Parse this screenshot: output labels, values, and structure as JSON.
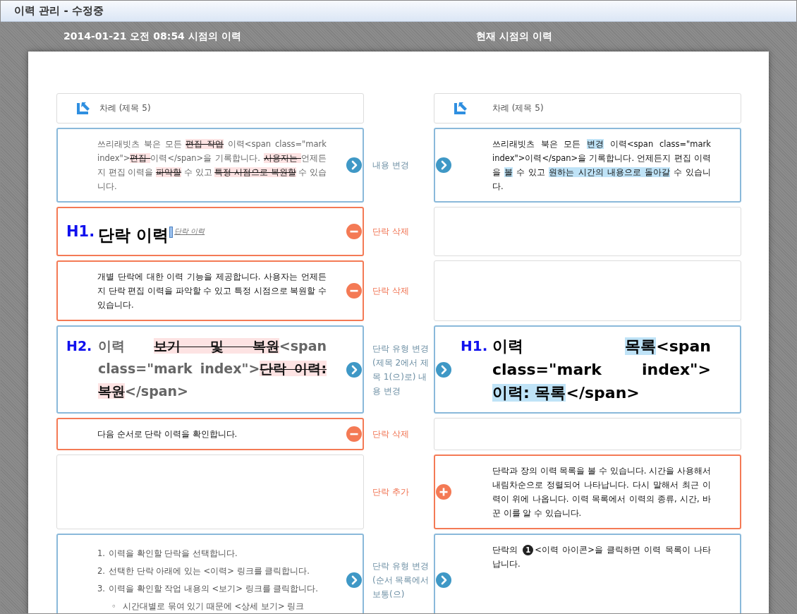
{
  "window": {
    "title": "이력 관리 - 수정중"
  },
  "columns": [
    {
      "title": "2014-01-21 오전 08:54 시점의 이력"
    },
    {
      "title": "현재 시점의 이력"
    }
  ],
  "rows": [
    {
      "left": {
        "kind": "toc",
        "text": "차례 (제목 5)"
      },
      "right": {
        "kind": "toc",
        "text": "차례 (제목 5)"
      }
    },
    {
      "left": {
        "kind": "paragraph",
        "segments": [
          {
            "text": "쓰리래빗츠 북은 모든 "
          },
          {
            "text": "편집 작업",
            "deleted": true
          },
          {
            "text": " 이력<span class=\"mark index\">"
          },
          {
            "text": "편집 ",
            "deleted": true
          },
          {
            "text": "이력</span>을 기록합니다. "
          },
          {
            "text": "사용자는 ",
            "deleted": true
          },
          {
            "text": "언제든지 편집 이력을 "
          },
          {
            "text": "파악할",
            "deleted": true
          },
          {
            "text": " 수 있고 "
          },
          {
            "text": "특정 시점으로 복원할",
            "deleted": true
          },
          {
            "text": " 수 있습니다."
          }
        ]
      },
      "change": {
        "kind": "modify",
        "label": "내용 변경"
      },
      "right": {
        "kind": "paragraph",
        "segments": [
          {
            "text": "쓰리래빗츠 북은 모든 "
          },
          {
            "text": "변경",
            "inserted": true
          },
          {
            "text": " 이력<span class=\"mark index\">이력</span>을 기록합니다. 언제든지 편집 이력을 "
          },
          {
            "text": "볼",
            "inserted": true
          },
          {
            "text": " 수 있고 "
          },
          {
            "text": "원하는 시간의 내용으로 돌아갈",
            "inserted": true
          },
          {
            "text": " 수 있습니다."
          }
        ]
      }
    },
    {
      "left": {
        "kind": "heading",
        "level": "H1.",
        "large": true,
        "segments": [
          {
            "text": "단락 이력"
          }
        ],
        "anchor": "단락 이력"
      },
      "change": {
        "kind": "delete",
        "label": "단락 삭제"
      },
      "right": {
        "kind": "empty"
      }
    },
    {
      "left": {
        "kind": "paragraph",
        "segments": [
          {
            "text": "개별 단락에 대한 이력 기능을 제공합니다. 사용자는 언제든지 단락 편집 이력을 파악할 수 있고 특정 시점으로 복원할 수 있습니다."
          }
        ]
      },
      "change": {
        "kind": "delete",
        "label": "단락 삭제"
      },
      "right": {
        "kind": "empty"
      }
    },
    {
      "left": {
        "kind": "heading",
        "level": "H2.",
        "large": false,
        "segments": [
          {
            "text": "이력 "
          },
          {
            "text": "보기 및 복원",
            "deleted": true
          },
          {
            "text": "<span class=\"mark index\">"
          },
          {
            "text": "단락 이력: 복원",
            "deleted": true
          },
          {
            "text": "</span>"
          }
        ]
      },
      "change": {
        "kind": "modify",
        "label": "단락 유형 변경(제목 2에서 제목 1(으)로) 내용 변경"
      },
      "right": {
        "kind": "heading",
        "level": "H1.",
        "large": false,
        "segments": [
          {
            "text": "이력 "
          },
          {
            "text": "목록",
            "inserted": true
          },
          {
            "text": "<span class=\"mark index\">"
          },
          {
            "text": "이력: 목록",
            "inserted": true
          },
          {
            "text": "</span>"
          }
        ]
      }
    },
    {
      "left": {
        "kind": "paragraph",
        "segments": [
          {
            "text": "다음 순서로 단락 이력을 확인합니다."
          }
        ]
      },
      "change": {
        "kind": "delete",
        "label": "단락 삭제"
      },
      "right": {
        "kind": "empty"
      }
    },
    {
      "left": {
        "kind": "empty"
      },
      "change": {
        "kind": "add",
        "label": "단락 추가"
      },
      "right": {
        "kind": "paragraph",
        "segments": [
          {
            "text": "단락과 장의 이력 목록을 볼 수 있습니다. 시간을 사용해서 내림차순으로 정렬되어 나타납니다. 다시 말해서 최근 이력이 위에 나옵니다. 이력 목록에서 이력의 종류, 시간, 바꾼 이를 알 수 있습니다."
          }
        ]
      }
    },
    {
      "left": {
        "kind": "list",
        "items": [
          {
            "marker": "1.",
            "text": "이력을 확인할 단락을 선택합니다."
          },
          {
            "marker": "2.",
            "text": "선택한 단락 아래에 있는 <이력> 링크를 클릭합니다."
          },
          {
            "marker": "3.",
            "text": "이력을 확인할 작업 내용의 <보기> 링크를 클릭합니다.",
            "children": [
              {
                "marker": "◦",
                "text": "시간대별로 묶여 있기 때문에 <상세 보기> 링크"
              }
            ]
          }
        ]
      },
      "change": {
        "kind": "modify",
        "label": "단락 유형 변경(순서 목록에서 보통(으)"
      },
      "right": {
        "kind": "paragraph",
        "segments": [
          {
            "text": "단락의 "
          },
          {
            "text": "1",
            "badge": true
          },
          {
            "text": "<이력 아이콘>을 클릭하면 이력 목록이 나타납니다."
          }
        ]
      }
    }
  ]
}
